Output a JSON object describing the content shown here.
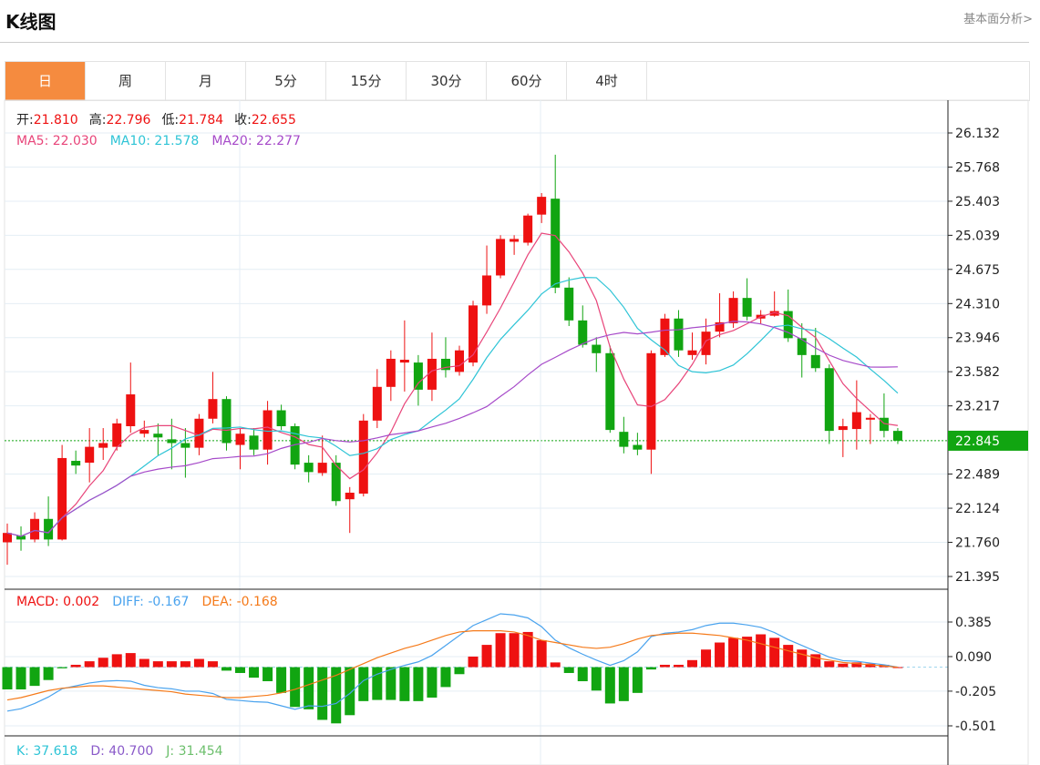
{
  "header": {
    "title": "K线图",
    "link": "基本面分析>"
  },
  "tabs": [
    "日",
    "周",
    "月",
    "5分",
    "15分",
    "30分",
    "60分",
    "4时"
  ],
  "active_tab": 0,
  "info": {
    "open_label": "开:",
    "open": "21.810",
    "high_label": "高:",
    "high": "22.796",
    "low_label": "低:",
    "low": "21.784",
    "close_label": "收:",
    "close": "22.655",
    "ma5": "MA5: 22.030",
    "ma10": "MA10: 21.578",
    "ma20": "MA20: 22.277"
  },
  "macd_info": {
    "macd": "MACD: 0.002",
    "diff": "DIFF: -0.167",
    "dea": "DEA: -0.168"
  },
  "kdj_info": {
    "k": "K: 37.618",
    "d": "D: 40.700",
    "j": "J: 31.454"
  },
  "colors": {
    "up": "#ee1111",
    "down": "#11a511",
    "ma5": "#e8457a",
    "ma10": "#2ec4d6",
    "ma20": "#a64ac9",
    "diff": "#4aa3ee",
    "dea": "#f57a1a"
  },
  "price_axis": [
    "26.132",
    "25.768",
    "25.403",
    "25.039",
    "24.675",
    "24.310",
    "23.946",
    "23.582",
    "23.217",
    "22.845",
    "22.489",
    "22.124",
    "21.760",
    "21.395"
  ],
  "macd_axis": [
    "0.385",
    "0.090",
    "-0.205",
    "-0.501"
  ],
  "current_price": "22.845",
  "chart_data": {
    "type": "candlestick",
    "ylim": [
      21.395,
      26.132
    ],
    "ohlc": [
      [
        21.76,
        21.96,
        21.52,
        21.86
      ],
      [
        21.83,
        21.93,
        21.67,
        21.79
      ],
      [
        21.79,
        22.08,
        21.76,
        22.01
      ],
      [
        22.01,
        22.25,
        21.72,
        21.79
      ],
      [
        21.79,
        22.8,
        21.78,
        22.66
      ],
      [
        22.63,
        22.74,
        22.49,
        22.58
      ],
      [
        22.61,
        22.98,
        22.4,
        22.78
      ],
      [
        22.77,
        22.98,
        22.64,
        22.82
      ],
      [
        22.78,
        23.08,
        22.74,
        23.03
      ],
      [
        23.0,
        23.68,
        22.93,
        23.34
      ],
      [
        22.92,
        23.06,
        22.88,
        22.96
      ],
      [
        22.92,
        23.03,
        22.69,
        22.88
      ],
      [
        22.86,
        23.08,
        22.54,
        22.82
      ],
      [
        22.82,
        22.98,
        22.45,
        22.77
      ],
      [
        22.77,
        23.13,
        22.69,
        23.08
      ],
      [
        23.08,
        23.58,
        23.03,
        23.29
      ],
      [
        23.29,
        23.32,
        22.74,
        22.82
      ],
      [
        22.8,
        22.98,
        22.54,
        22.92
      ],
      [
        22.9,
        22.98,
        22.69,
        22.75
      ],
      [
        22.75,
        23.27,
        22.59,
        23.17
      ],
      [
        23.17,
        23.23,
        22.96,
        23.0
      ],
      [
        23.0,
        23.03,
        22.54,
        22.59
      ],
      [
        22.61,
        22.69,
        22.4,
        22.51
      ],
      [
        22.5,
        22.9,
        22.47,
        22.61
      ],
      [
        22.61,
        22.69,
        22.15,
        22.2
      ],
      [
        22.22,
        22.35,
        21.86,
        22.29
      ],
      [
        22.28,
        23.13,
        22.25,
        23.06
      ],
      [
        23.06,
        23.61,
        22.98,
        23.42
      ],
      [
        23.42,
        23.81,
        23.27,
        23.72
      ],
      [
        23.68,
        24.13,
        23.37,
        23.71
      ],
      [
        23.68,
        23.76,
        23.22,
        23.39
      ],
      [
        23.39,
        24.0,
        23.27,
        23.72
      ],
      [
        23.72,
        23.95,
        23.52,
        23.6
      ],
      [
        23.58,
        23.86,
        23.54,
        23.81
      ],
      [
        23.68,
        24.34,
        23.64,
        24.29
      ],
      [
        24.29,
        24.93,
        24.2,
        24.61
      ],
      [
        24.61,
        25.04,
        24.58,
        25.0
      ],
      [
        24.97,
        25.04,
        24.83,
        25.0
      ],
      [
        24.96,
        25.27,
        24.93,
        25.25
      ],
      [
        25.26,
        25.49,
        25.17,
        25.45
      ],
      [
        25.43,
        25.9,
        24.42,
        24.48
      ],
      [
        24.48,
        24.59,
        24.07,
        24.13
      ],
      [
        24.13,
        24.29,
        23.84,
        23.87
      ],
      [
        23.87,
        23.95,
        23.58,
        23.78
      ],
      [
        23.78,
        23.86,
        22.93,
        22.96
      ],
      [
        22.94,
        23.1,
        22.71,
        22.78
      ],
      [
        22.8,
        22.93,
        22.69,
        22.75
      ],
      [
        22.75,
        23.81,
        22.49,
        23.78
      ],
      [
        23.76,
        24.2,
        23.74,
        24.15
      ],
      [
        24.15,
        24.24,
        23.74,
        23.81
      ],
      [
        23.76,
        24.0,
        23.71,
        23.81
      ],
      [
        23.76,
        24.15,
        23.66,
        24.01
      ],
      [
        24.01,
        24.42,
        23.95,
        24.11
      ],
      [
        24.1,
        24.44,
        24.05,
        24.37
      ],
      [
        24.37,
        24.58,
        24.13,
        24.17
      ],
      [
        24.15,
        24.24,
        24.09,
        24.19
      ],
      [
        24.18,
        24.44,
        24.17,
        24.23
      ],
      [
        24.23,
        24.46,
        23.9,
        23.94
      ],
      [
        23.94,
        24.1,
        23.52,
        23.76
      ],
      [
        23.76,
        24.05,
        23.58,
        23.62
      ],
      [
        23.62,
        23.66,
        22.81,
        22.95
      ],
      [
        22.96,
        23.08,
        22.67,
        23.0
      ],
      [
        22.97,
        23.49,
        22.75,
        23.15
      ],
      [
        23.07,
        23.13,
        22.81,
        23.09
      ],
      [
        23.09,
        23.35,
        22.88,
        22.95
      ],
      [
        22.95,
        22.98,
        22.81,
        22.845
      ]
    ],
    "macd": [
      -0.19,
      -0.19,
      -0.16,
      -0.11,
      -0.01,
      0.02,
      0.05,
      0.08,
      0.11,
      0.12,
      0.07,
      0.05,
      0.05,
      0.05,
      0.07,
      0.05,
      -0.03,
      -0.05,
      -0.09,
      -0.12,
      -0.22,
      -0.34,
      -0.36,
      -0.45,
      -0.48,
      -0.41,
      -0.29,
      -0.28,
      -0.28,
      -0.29,
      -0.29,
      -0.26,
      -0.17,
      -0.06,
      0.09,
      0.19,
      0.29,
      0.29,
      0.3,
      0.23,
      0.04,
      -0.05,
      -0.12,
      -0.2,
      -0.31,
      -0.29,
      -0.22,
      -0.02,
      0.02,
      0.02,
      0.06,
      0.15,
      0.21,
      0.25,
      0.26,
      0.28,
      0.25,
      0.19,
      0.15,
      0.11,
      0.05,
      0.03,
      0.04,
      0.03,
      0.02,
      0.0
    ],
    "dea": [
      -0.28,
      -0.26,
      -0.23,
      -0.2,
      -0.18,
      -0.17,
      -0.16,
      -0.16,
      -0.17,
      -0.18,
      -0.19,
      -0.2,
      -0.21,
      -0.23,
      -0.24,
      -0.25,
      -0.26,
      -0.26,
      -0.25,
      -0.24,
      -0.22,
      -0.19,
      -0.15,
      -0.11,
      -0.07,
      -0.02,
      0.03,
      0.08,
      0.12,
      0.16,
      0.19,
      0.23,
      0.27,
      0.3,
      0.31,
      0.31,
      0.31,
      0.3,
      0.27,
      0.23,
      0.21,
      0.19,
      0.17,
      0.16,
      0.17,
      0.2,
      0.24,
      0.27,
      0.28,
      0.29,
      0.29,
      0.28,
      0.27,
      0.25,
      0.23,
      0.2,
      0.17,
      0.14,
      0.11,
      0.08,
      0.06,
      0.04,
      0.03,
      0.02,
      0.01,
      0.0
    ],
    "macd_ylim": [
      -0.501,
      0.385
    ]
  }
}
